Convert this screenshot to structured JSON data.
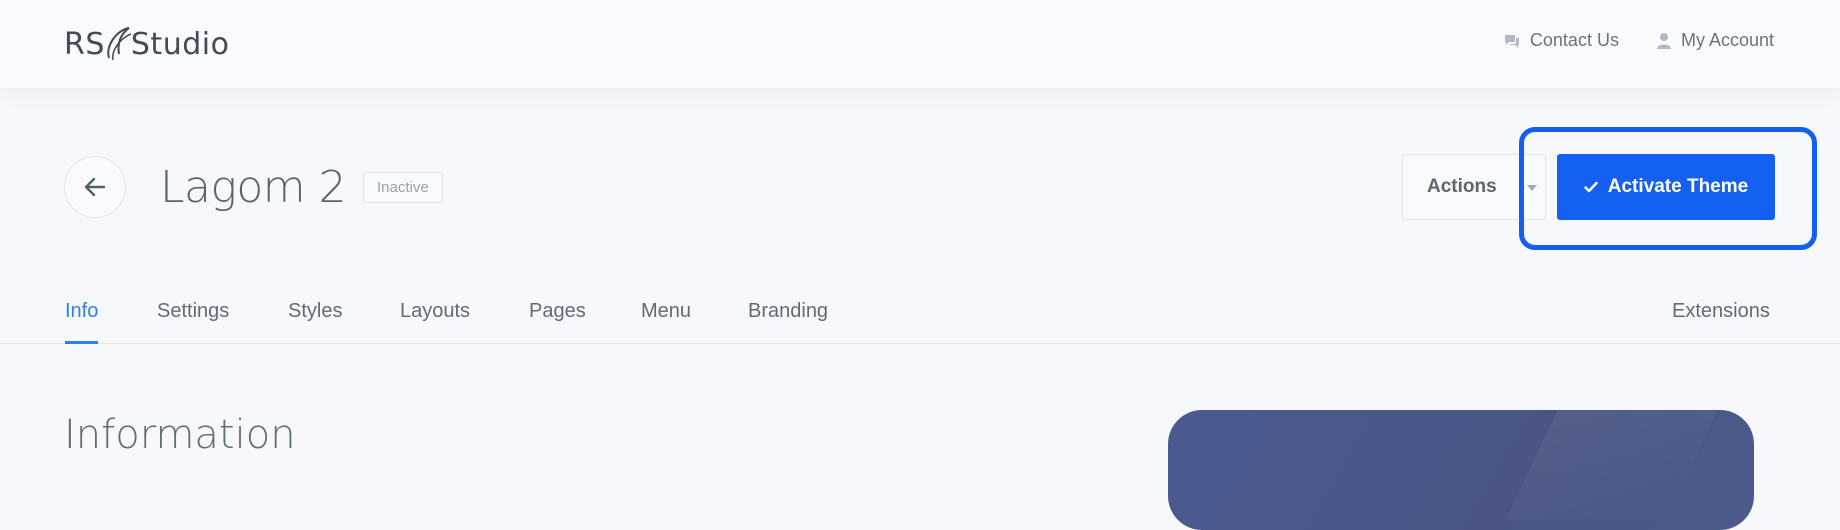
{
  "brand": {
    "prefix": "RS",
    "name": "Studio"
  },
  "top_nav": {
    "contact_label": "Contact Us",
    "account_label": "My Account"
  },
  "header": {
    "title": "Lagom 2",
    "status": "Inactive",
    "actions_label": "Actions",
    "activate_label": "Activate Theme"
  },
  "tabs": [
    {
      "label": "Info",
      "active": true
    },
    {
      "label": "Settings"
    },
    {
      "label": "Styles"
    },
    {
      "label": "Layouts"
    },
    {
      "label": "Pages"
    },
    {
      "label": "Menu"
    },
    {
      "label": "Branding"
    },
    {
      "label": "Extensions"
    }
  ],
  "main": {
    "section_title": "Information"
  },
  "colors": {
    "accent": "#1460f2",
    "highlight": "#1160f0",
    "active_tab": "#2e7ff0",
    "preview_bg": "#4a5584"
  }
}
